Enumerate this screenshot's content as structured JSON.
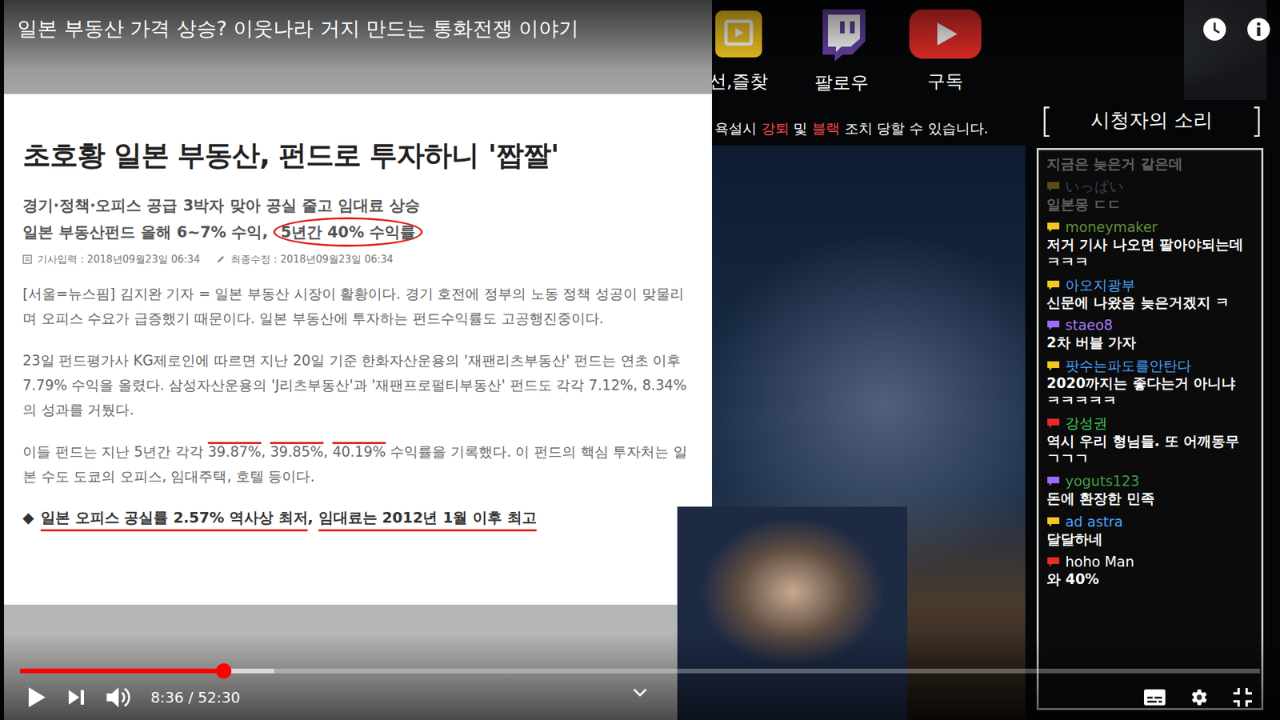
{
  "video": {
    "title": "일본 부동산 가격 상승? 이웃나라 거지 만드는 통화전쟁 이야기",
    "time": "8:36 / 52:30",
    "played": 0.164,
    "buffered": 0.205
  },
  "article": {
    "headline": "초호황 일본 부동산, 펀드로 투자하니 '짭짤'",
    "subheads": [
      [
        {
          "text": "경기·정책·오피스 공급 3박자 맞아 공실 줄고 임대료 상승",
          "mark": "none"
        }
      ],
      [
        {
          "text": "일본 부동산펀드 올해 6~7% 수익, ",
          "mark": "none"
        },
        {
          "text": "5년간 40% 수익률",
          "mark": "circle"
        }
      ]
    ],
    "meta": [
      "기사입력 : 2018년09월23일 06:34",
      "최종수정 : 2018년09월23일 06:34"
    ],
    "paragraphs": [
      [
        {
          "text": "[서울=뉴스핌] 김지완 기자 = 일본 부동산 시장이 활황이다. 경기 호전에 정부의 노동 정책 성공이 맞물리며 오피스 수요가 급증했기 때문이다. 일본 부동산에 투자하는 펀드수익률도 고공행진중이다.",
          "mark": "none"
        }
      ],
      [
        {
          "text": "23일 펀드평가사 KG제로인에 따르면 지난 20일 기준 한화자산운용의 '재팬리츠부동산' 펀드는 연초 이후 7.79% 수익을 올렸다. 삼성자산운용의 'J리츠부동산'과 '재팬프로펄티부동산' 펀드도 각각 7.12%, 8.34%의 성과를 거뒀다.",
          "mark": "none"
        }
      ],
      [
        {
          "text": "이들 펀드는 지난 5년간 각각 ",
          "mark": "none"
        },
        {
          "text": "39.87%",
          "mark": "overline"
        },
        {
          "text": ", ",
          "mark": "none"
        },
        {
          "text": "39.85%",
          "mark": "overline"
        },
        {
          "text": ", ",
          "mark": "none"
        },
        {
          "text": "40.19%",
          "mark": "overline"
        },
        {
          "text": " 수익률을 기록했다. 이 펀드의 핵심 투자처는 일본 수도 도쿄의 오피스, 임대주택, 호텔 등이다.",
          "mark": "none"
        }
      ]
    ],
    "highlight": {
      "bullet": "◆",
      "segments": [
        {
          "text": "일본 오피스 공실률 2.57% 역사상 최저",
          "mark": "underline"
        },
        {
          "text": ", ",
          "mark": "none"
        },
        {
          "text": "임대료는 2012년 1월 이후 최고",
          "mark": "underline"
        }
      ]
    }
  },
  "overlay": {
    "buttons": [
      {
        "kind": "bookmark",
        "label": "선,즐찾",
        "color": "#f3c623"
      },
      {
        "kind": "twitch",
        "label": "팔로우",
        "color": "#6441a5"
      },
      {
        "kind": "youtube",
        "label": "구독",
        "color": "#e52d27"
      }
    ],
    "notice": [
      {
        "text": "욕설시 ",
        "color": "#ffffff"
      },
      {
        "text": "강퇴",
        "color": "#ff4a4a"
      },
      {
        "text": " 및 ",
        "color": "#ffffff"
      },
      {
        "text": "블랙",
        "color": "#ff4a4a"
      },
      {
        "text": " 조치 당할 수 있습니다.",
        "color": "#ffffff"
      }
    ]
  },
  "chat": {
    "bracket_left": "[",
    "title": "시청자의 소리",
    "bracket_right": "]",
    "messages": [
      {
        "kind": "continued",
        "message": "지금은 늦은거 같은데",
        "faded": true
      },
      {
        "kind": "full",
        "user": "いっぱい",
        "message": "일본몽 ㄷㄷ",
        "color": "#f3c623",
        "name_color": "#9aa0c8",
        "faded": true
      },
      {
        "kind": "full",
        "user": "moneymaker",
        "message": "저거 기사 나오면 팔아야되는데 ㅋㅋㅋ",
        "color": "#f3c623",
        "name_color": "#5f8f3e",
        "faded": false
      },
      {
        "kind": "full",
        "user": "아오지광부",
        "message": "신문에 나왔음 늦은거겠지 ㅋ",
        "color": "#f3c623",
        "name_color": "#4aa3ff",
        "faded": false
      },
      {
        "kind": "full",
        "user": "staeo8",
        "message": "2차 버블 가자",
        "color": "#9b6bff",
        "name_color": "#a978ff",
        "faded": false
      },
      {
        "kind": "full",
        "user": "팟수는파도를안탄다",
        "message": "2020까지는 좋다는거 아니냐 ㅋㅋㅋㅋㅋ",
        "color": "#f3c623",
        "name_color": "#4aa3ff",
        "faded": false
      },
      {
        "kind": "full",
        "user": "강성권",
        "message": "역시 우리 형님들. 또 어깨동무 ㄱㄱㄱ",
        "color": "#e52d27",
        "name_color": "#3fcf5a",
        "faded": false
      },
      {
        "kind": "full",
        "user": "yoguts123",
        "message": "돈에 환장한 민족",
        "color": "#9b6bff",
        "name_color": "#3f9f4a",
        "faded": false
      },
      {
        "kind": "full",
        "user": "ad astra",
        "message": "달달하네",
        "color": "#f3c623",
        "name_color": "#4aa3ff",
        "faded": false
      },
      {
        "kind": "full",
        "user": "hoho Man",
        "message": "와 40%",
        "color": "#e52d27",
        "name_color": "#ffffff",
        "faded": false
      }
    ]
  }
}
